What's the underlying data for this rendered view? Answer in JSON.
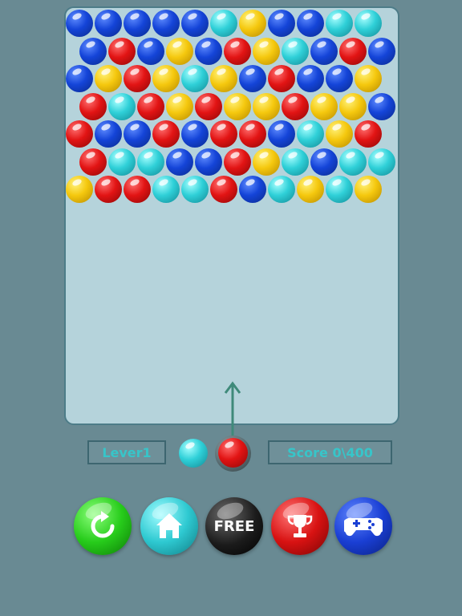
{
  "game": {
    "level_label": "Lever1",
    "score_label": "Score 0\\400"
  },
  "colors": {
    "background": "#698a93",
    "board": "#b5d3db",
    "label_text": "#37c5c9",
    "Y": "yellow",
    "R": "red",
    "B": "blue",
    "C": "cyan"
  },
  "grid": {
    "rows": [
      "BBBBBCYBBCC",
      "BRBYBRYCBRB",
      "BYRYCYBRBBY",
      "RCRYRYYRYYB",
      "RBBRBRRBCYR",
      "RCCBBRYCBCC",
      "YRRCCRBCYCY"
    ]
  },
  "shooter": {
    "next_color": "cyan",
    "current_color": "red"
  },
  "menu": {
    "restart_icon": "restart-icon",
    "home_icon": "home-icon",
    "free_label": "FREE",
    "trophy_icon": "trophy-icon",
    "games_icon": "gamepad-icon"
  }
}
